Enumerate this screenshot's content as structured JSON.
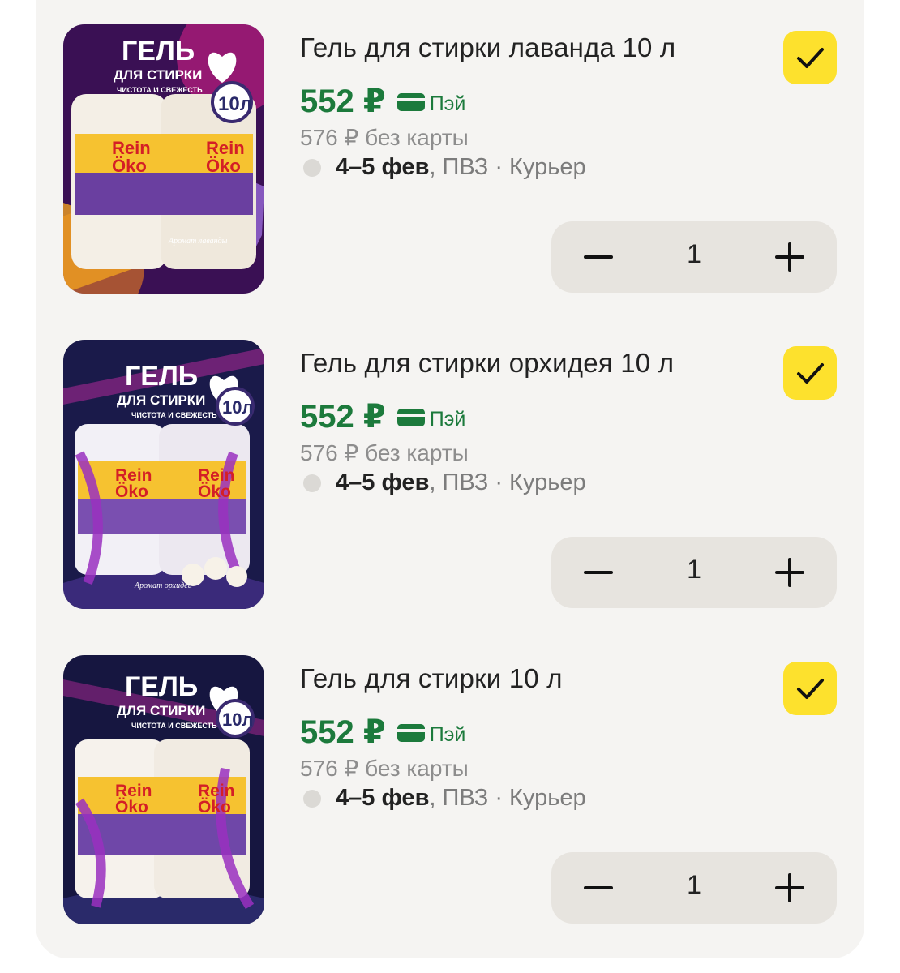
{
  "currency": "₽",
  "brand_color": "#1c7a3c",
  "checkbox_color": "#fde12d",
  "items": [
    {
      "title": "Гель для стирки лаванда 10 л",
      "price": "552 ₽",
      "pay_label": "Пэй",
      "old_price": "576 ₽ без карты",
      "delivery_dates": "4–5 фев",
      "delivery_methods": ", ПВЗ · Курьер",
      "quantity": "1",
      "checked": true,
      "image": {
        "headline": "ГЕЛЬ",
        "subline": "ДЛЯ СТИРКИ",
        "tagline": "ЧИСТОТА И СВЕЖЕСТЬ",
        "volume": "10л",
        "brand_top": "Rein",
        "brand_bottom": "Öko",
        "aroma": "Аромат лаванды",
        "background": "#3a1054"
      }
    },
    {
      "title": "Гель для стирки орхидея 10 л",
      "price": "552 ₽",
      "pay_label": "Пэй",
      "old_price": "576 ₽ без карты",
      "delivery_dates": "4–5 фев",
      "delivery_methods": ", ПВЗ · Курьер",
      "quantity": "1",
      "checked": true,
      "image": {
        "headline": "ГЕЛЬ",
        "subline": "ДЛЯ СТИРКИ",
        "tagline": "ЧИСТОТА И СВЕЖЕСТЬ",
        "volume": "10л",
        "brand_top": "Rein",
        "brand_bottom": "Öko",
        "aroma": "Аромат орхидеи",
        "background": "#1a1a4a"
      }
    },
    {
      "title": "Гель для стирки 10 л",
      "price": "552 ₽",
      "pay_label": "Пэй",
      "old_price": "576 ₽ без карты",
      "delivery_dates": "4–5 фев",
      "delivery_methods": ", ПВЗ · Курьер",
      "quantity": "1",
      "checked": true,
      "image": {
        "headline": "ГЕЛЬ",
        "subline": "ДЛЯ СТИРКИ",
        "tagline": "ЧИСТОТА И СВЕЖЕСТЬ",
        "volume": "10л",
        "brand_top": "Rein",
        "brand_bottom": "Öko",
        "aroma": "",
        "background": "#161640"
      }
    }
  ]
}
